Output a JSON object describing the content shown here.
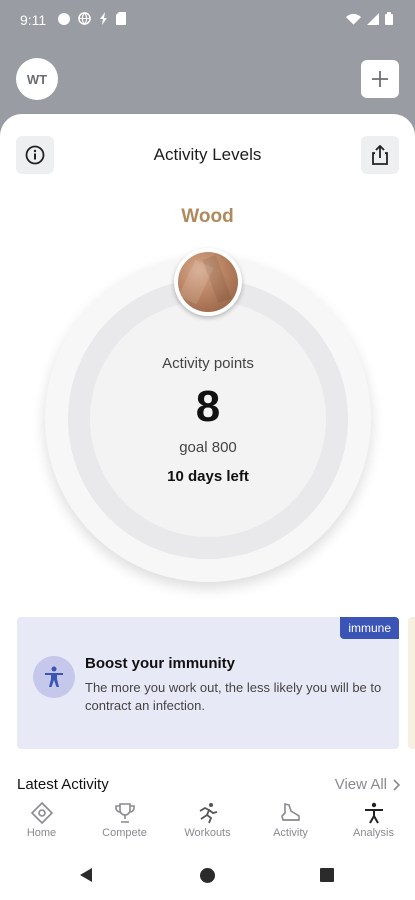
{
  "status_bar": {
    "time": "9:11",
    "icons": [
      "circle-dot-icon",
      "globe-icon",
      "flash-icon",
      "sd-card-icon"
    ],
    "right_icons": [
      "wifi-icon",
      "signal-icon",
      "battery-icon"
    ]
  },
  "header": {
    "avatar_initials": "WT",
    "add_icon": "plus-icon"
  },
  "sheet": {
    "title": "Activity Levels",
    "info_icon": "info-icon",
    "share_icon": "share-icon"
  },
  "level": {
    "name": "Wood",
    "name_color": "#b08a5d",
    "badge_icon": "wood-badge-icon",
    "points_label": "Activity points",
    "points_value": "8",
    "goal_text": "goal 800",
    "days_left": "10 days left"
  },
  "promo": {
    "tag": "immune",
    "tag_color": "#3a55b5",
    "icon": "person-icon",
    "title": "Boost your immunity",
    "body": "The more you work out, the less likely you will be to contract an infection."
  },
  "latest": {
    "title": "Latest Activity",
    "view_all": "View All"
  },
  "nav": {
    "items": [
      {
        "label": "Home",
        "icon": "home-icon"
      },
      {
        "label": "Compete",
        "icon": "trophy-icon"
      },
      {
        "label": "Workouts",
        "icon": "runner-icon"
      },
      {
        "label": "Activity",
        "icon": "shoe-icon"
      },
      {
        "label": "Analysis",
        "icon": "figure-icon"
      }
    ]
  }
}
